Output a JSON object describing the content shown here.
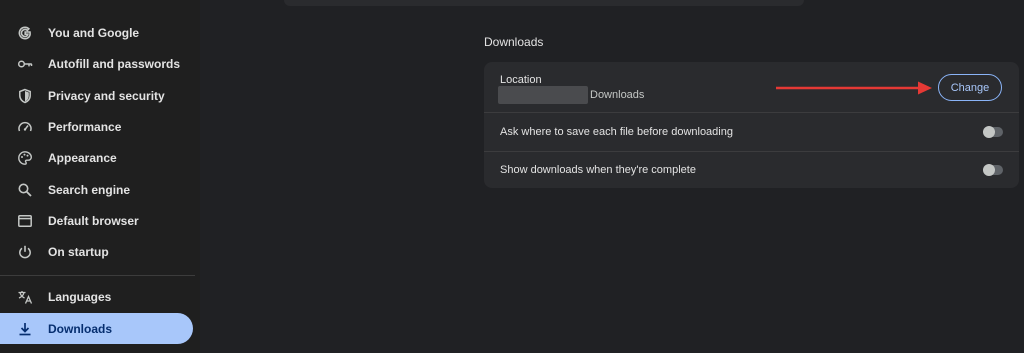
{
  "sidebar": {
    "items": [
      {
        "label": "You and Google",
        "icon": "google-icon"
      },
      {
        "label": "Autofill and passwords",
        "icon": "key-icon"
      },
      {
        "label": "Privacy and security",
        "icon": "shield-icon"
      },
      {
        "label": "Performance",
        "icon": "speedometer-icon"
      },
      {
        "label": "Appearance",
        "icon": "palette-icon"
      },
      {
        "label": "Search engine",
        "icon": "search-icon"
      },
      {
        "label": "Default browser",
        "icon": "browser-window-icon"
      },
      {
        "label": "On startup",
        "icon": "power-icon"
      },
      {
        "label": "Languages",
        "icon": "translate-icon"
      },
      {
        "label": "Downloads",
        "icon": "download-icon",
        "active": true
      }
    ]
  },
  "downloads": {
    "section_title": "Downloads",
    "location_label": "Location",
    "location_suffix": "Downloads",
    "change_label": "Change",
    "settings": [
      {
        "label": "Ask where to save each file before downloading",
        "enabled": false
      },
      {
        "label": "Show downloads when they're complete",
        "enabled": false
      }
    ]
  },
  "colors": {
    "background": "#202124",
    "card": "#2a2b2e",
    "active_nav": "#a8c7fa",
    "accent": "#8ab4f8",
    "annotation_arrow": "#e53935"
  }
}
